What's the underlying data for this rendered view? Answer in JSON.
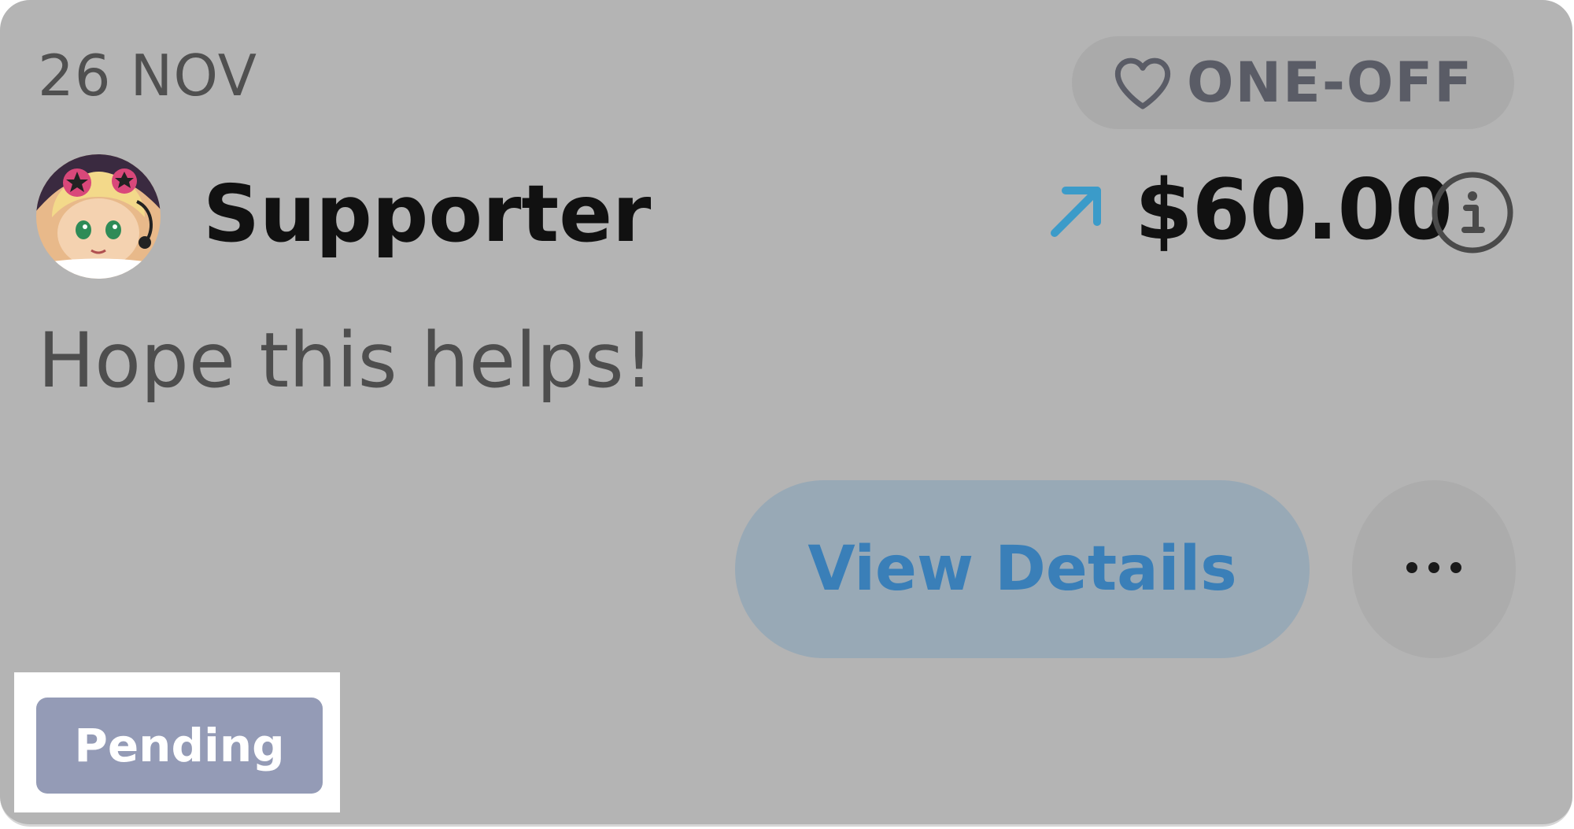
{
  "donation": {
    "date": "26 NOV",
    "type": "ONE-OFF",
    "type_icon": "heart-icon",
    "supporter_name": "Supporter",
    "direction_icon": "arrow-up-right-icon",
    "amount": "$60.00",
    "info_icon": "info-icon",
    "message": "Hope this helps!",
    "status": "Pending"
  },
  "actions": {
    "view_details_label": "View Details",
    "more_icon": "more-options-icon"
  },
  "colors": {
    "card_background": "#b4b4b4",
    "accent_blue": "#3a7fb8",
    "arrow_blue": "#3b9bc9",
    "status_badge": "#949bb6"
  }
}
